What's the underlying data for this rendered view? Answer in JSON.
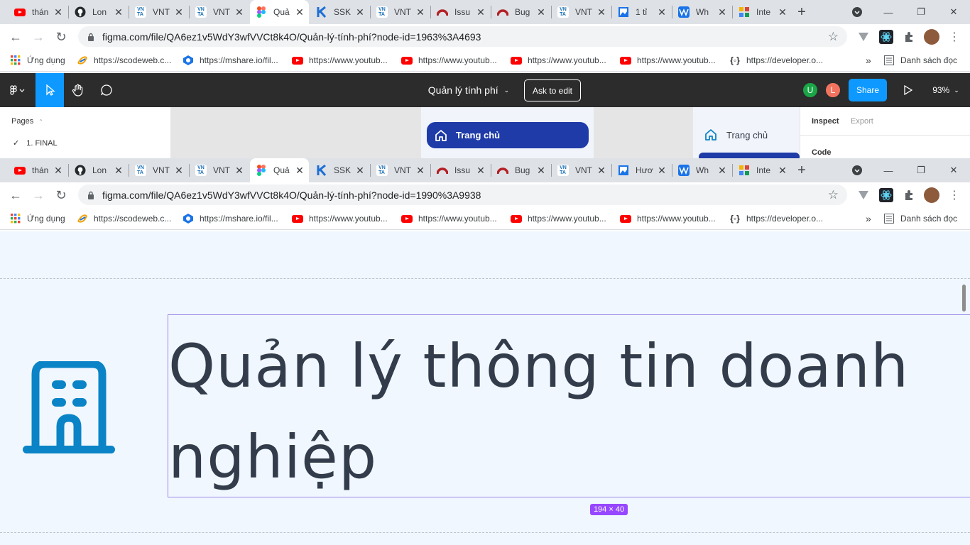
{
  "window1": {
    "tabs": [
      {
        "title": "thán",
        "icon": "youtube-icon"
      },
      {
        "title": "Lon",
        "icon": "github-icon"
      },
      {
        "title": "VNT",
        "icon": "vnta-icon"
      },
      {
        "title": "VNT",
        "icon": "vnta-icon"
      },
      {
        "title": "Quả",
        "icon": "figma-icon",
        "active": true
      },
      {
        "title": "SSK",
        "icon": "k-icon"
      },
      {
        "title": "VNT",
        "icon": "vnta-icon"
      },
      {
        "title": "Issu",
        "icon": "redmine-icon"
      },
      {
        "title": "Bug",
        "icon": "redmine-icon"
      },
      {
        "title": "VNT",
        "icon": "vnta-icon"
      },
      {
        "title": "1 tỉ",
        "icon": "image-icon"
      },
      {
        "title": "Wh",
        "icon": "wave-icon"
      },
      {
        "title": "Inte",
        "icon": "grid-icon"
      }
    ],
    "url": "figma.com/file/QA6ez1v5WdY3wfVVCt8k4O/Quản-lý-tính-phí?node-id=1963%3A4693"
  },
  "window2": {
    "tabs": [
      {
        "title": "thán",
        "icon": "youtube-icon"
      },
      {
        "title": "Lon",
        "icon": "github-icon"
      },
      {
        "title": "VNT",
        "icon": "vnta-icon"
      },
      {
        "title": "VNT",
        "icon": "vnta-icon"
      },
      {
        "title": "Quả",
        "icon": "figma-icon",
        "active": true
      },
      {
        "title": "SSK",
        "icon": "k-icon"
      },
      {
        "title": "VNT",
        "icon": "vnta-icon"
      },
      {
        "title": "Issu",
        "icon": "redmine-icon"
      },
      {
        "title": "Bug",
        "icon": "redmine-icon"
      },
      {
        "title": "VNT",
        "icon": "vnta-icon"
      },
      {
        "title": "Hươ",
        "icon": "image-icon"
      },
      {
        "title": "Wh",
        "icon": "wave-icon"
      },
      {
        "title": "Inte",
        "icon": "grid-icon"
      }
    ],
    "url": "figma.com/file/QA6ez1v5WdY3wfVVCt8k4O/Quản-lý-tính-phí?node-id=1990%3A9938"
  },
  "bookmarks": {
    "apps": "Ứng dụng",
    "items": [
      "https://scodeweb.c...",
      "https://mshare.io/fil...",
      "https://www.youtub...",
      "https://www.youtub...",
      "https://www.youtub...",
      "https://www.youtub...",
      "https://developer.o..."
    ],
    "more": "»",
    "reading_list": "Danh sách đọc"
  },
  "figma": {
    "file_name": "Quản lý tính phí",
    "ask_to_edit": "Ask to edit",
    "share": "Share",
    "zoom": "93%",
    "avatars": [
      "U",
      "L"
    ],
    "pages_label": "Pages",
    "page_item": "1. FINAL",
    "nav_active_label": "Trang chủ",
    "nav_label_2": "Trang chủ",
    "inspect_tab": "Inspect",
    "export_tab": "Export",
    "code_label": "Code"
  },
  "canvas": {
    "heading": "Quản lý thông tin doanh nghiệp",
    "size_badge": "194 × 40"
  },
  "colors": {
    "accent_blue": "#0d99ff",
    "nav_blue": "#1e3ba8",
    "building_icon": "#0a84c6",
    "heading_text": "#323c4b",
    "selection_purple": "#9747ff"
  }
}
